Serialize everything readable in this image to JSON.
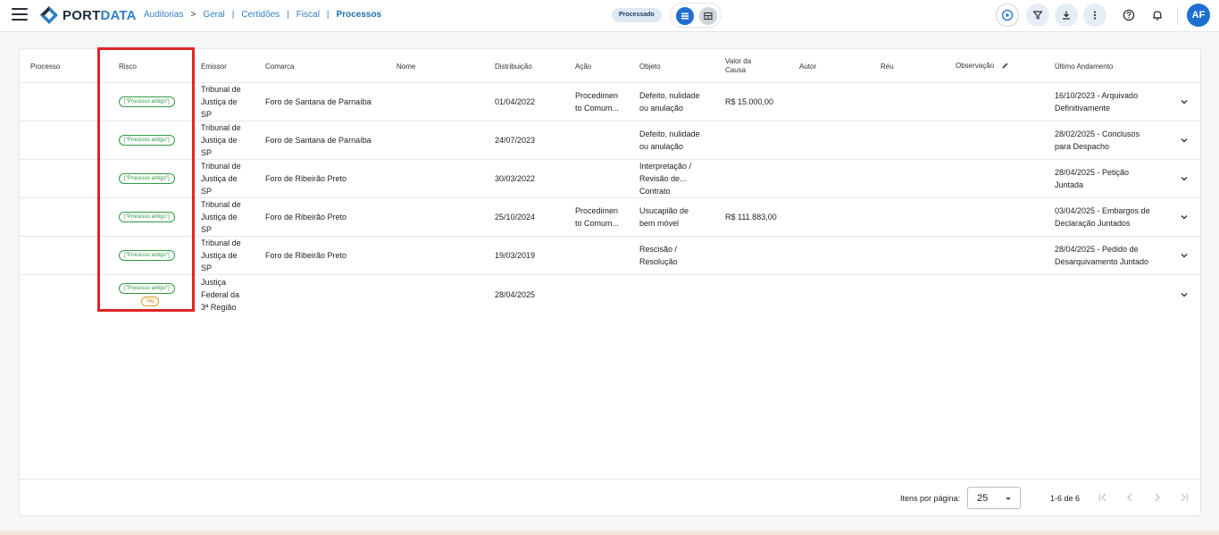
{
  "app": {
    "logo_part1": "PORT",
    "logo_part2": "DATA"
  },
  "breadcrumb": {
    "items": [
      "Auditorias",
      "Geral",
      "Certidões",
      "Fiscal",
      "Processos"
    ],
    "separator": ">",
    "bar": "|"
  },
  "toolbar": {
    "status_chip": "Processado",
    "avatar_initials": "AF"
  },
  "table": {
    "headers": {
      "processo": "Processo",
      "risco": "Risco",
      "emissor": "Emissor",
      "comarca": "Comarca",
      "nome": "Nome",
      "distribuicao": "Distribuição",
      "acao": "Ação",
      "objeto": "Objeto",
      "valor_causa_1": "Valor da",
      "valor_causa_2": "Causa",
      "autor": "Autor",
      "reu": "Réu",
      "observacao": "Observação",
      "ultimo_andamento": "Último Andamento"
    },
    "rows": [
      {
        "risco": "[\"Processo antigo\"]",
        "emissor": [
          "Tribunal de",
          "Justiça de",
          "SP"
        ],
        "comarca": "Foro de Santana de Parnaíba",
        "distribuicao": "01/04/2022",
        "acao": [
          "Procedimen",
          "to Comum..."
        ],
        "objeto": [
          "Defeito, nulidade",
          "ou anulação"
        ],
        "valor": "R$ 15.000,00",
        "andamento": [
          "16/10/2023 - Arquivado",
          "Definitivamente"
        ]
      },
      {
        "risco": "[\"Processo antigo\"]",
        "emissor": [
          "Tribunal de",
          "Justiça de",
          "SP"
        ],
        "comarca": "Foro de Santana de Parnaíba",
        "distribuicao": "24/07/2023",
        "acao": [],
        "objeto": [
          "Defeito, nulidade",
          "ou anulação"
        ],
        "valor": "",
        "andamento": [
          "28/02/2025 - Conclusos",
          "para Despacho"
        ]
      },
      {
        "risco": "[\"Processo antigo\"]",
        "emissor": [
          "Tribunal de",
          "Justiça de",
          "SP"
        ],
        "comarca": "Foro de Ribeirão Preto",
        "distribuicao": "30/03/2022",
        "acao": [],
        "objeto": [
          "Interpretação /",
          "Revisão de...",
          "Contrato"
        ],
        "valor": "",
        "andamento": [
          "28/04/2025 - Petição",
          "Juntada"
        ]
      },
      {
        "risco": "[\"Processo antigo\"]",
        "emissor": [
          "Tribunal de",
          "Justiça de",
          "SP"
        ],
        "comarca": "Foro de Ribeirão Preto",
        "distribuicao": "25/10/2024",
        "acao": [
          "Procedimen",
          "to Comum..."
        ],
        "objeto": [
          "Usucapião de",
          "bem móvel"
        ],
        "valor": "R$ 111.883,00",
        "andamento": [
          "03/04/2025 - Embargos de",
          "Declaração Juntados"
        ]
      },
      {
        "risco": "[\"Processo antigo\"]",
        "emissor": [
          "Tribunal de",
          "Justiça de",
          "SP"
        ],
        "comarca": "Foro de Ribeirão Preto",
        "distribuicao": "19/03/2019",
        "acao": [],
        "objeto": [
          "Rescisão /",
          "Resolução"
        ],
        "valor": "",
        "andamento": [
          "28/04/2025 - Pedido de",
          "Desarquivamento Juntado"
        ]
      },
      {
        "risco": "[\"Processo antigo\"]",
        "tag": "tag",
        "emissor": [
          "Justiça",
          "Federal da",
          "3ª Região"
        ],
        "comarca": "",
        "distribuicao": "28/04/2025",
        "acao": [],
        "objeto": [],
        "valor": "",
        "andamento": []
      }
    ]
  },
  "pagination": {
    "items_per_page_label": "Itens por página:",
    "items_per_page_value": "25",
    "range_label": "1-6 de 6"
  },
  "colors": {
    "accent": "#1f6fd1",
    "risk_green": "#2e9b45",
    "tag_orange": "#e29a23",
    "highlight_red": "#e02424"
  }
}
